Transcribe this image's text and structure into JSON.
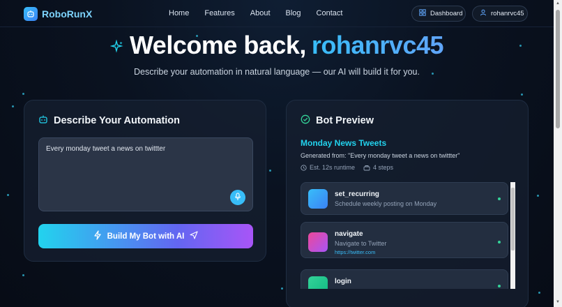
{
  "brand": {
    "name": "RoboRunX"
  },
  "nav": {
    "links": [
      "Home",
      "Features",
      "About",
      "Blog",
      "Contact"
    ]
  },
  "actions": {
    "dashboard_label": "Dashboard",
    "user_label": "rohanrvc45"
  },
  "hero": {
    "title_prefix": "Welcome back, ",
    "title_user": "rohanrvc45",
    "subtitle": "Describe your automation in natural language — our AI will build it for you."
  },
  "describe": {
    "title": "Describe Your Automation",
    "input_value": "Every monday tweet a news on twittter",
    "build_label": "Build My Bot with AI"
  },
  "preview": {
    "title": "Bot Preview",
    "bot_name": "Monday News Tweets",
    "generated_from": "Generated from: \"Every monday tweet a news on twittter\"",
    "runtime": "Est. 12s runtime",
    "steps_count": "4 steps",
    "steps": [
      {
        "name": "set_recurring",
        "desc": "Schedule weekly posting on Monday",
        "url": "",
        "color_from": "#38bdf8",
        "color_to": "#3b82f6"
      },
      {
        "name": "navigate",
        "desc": "Navigate to Twitter",
        "url": "https://twitter.com",
        "color_from": "#ec4899",
        "color_to": "#a855f7"
      },
      {
        "name": "login",
        "desc": "",
        "url": "",
        "color_from": "#34d399",
        "color_to": "#10b981"
      }
    ]
  },
  "colors": {
    "accent": "#22d3ee",
    "user_accent": "#60a5fa",
    "status_ok": "#34d399"
  }
}
